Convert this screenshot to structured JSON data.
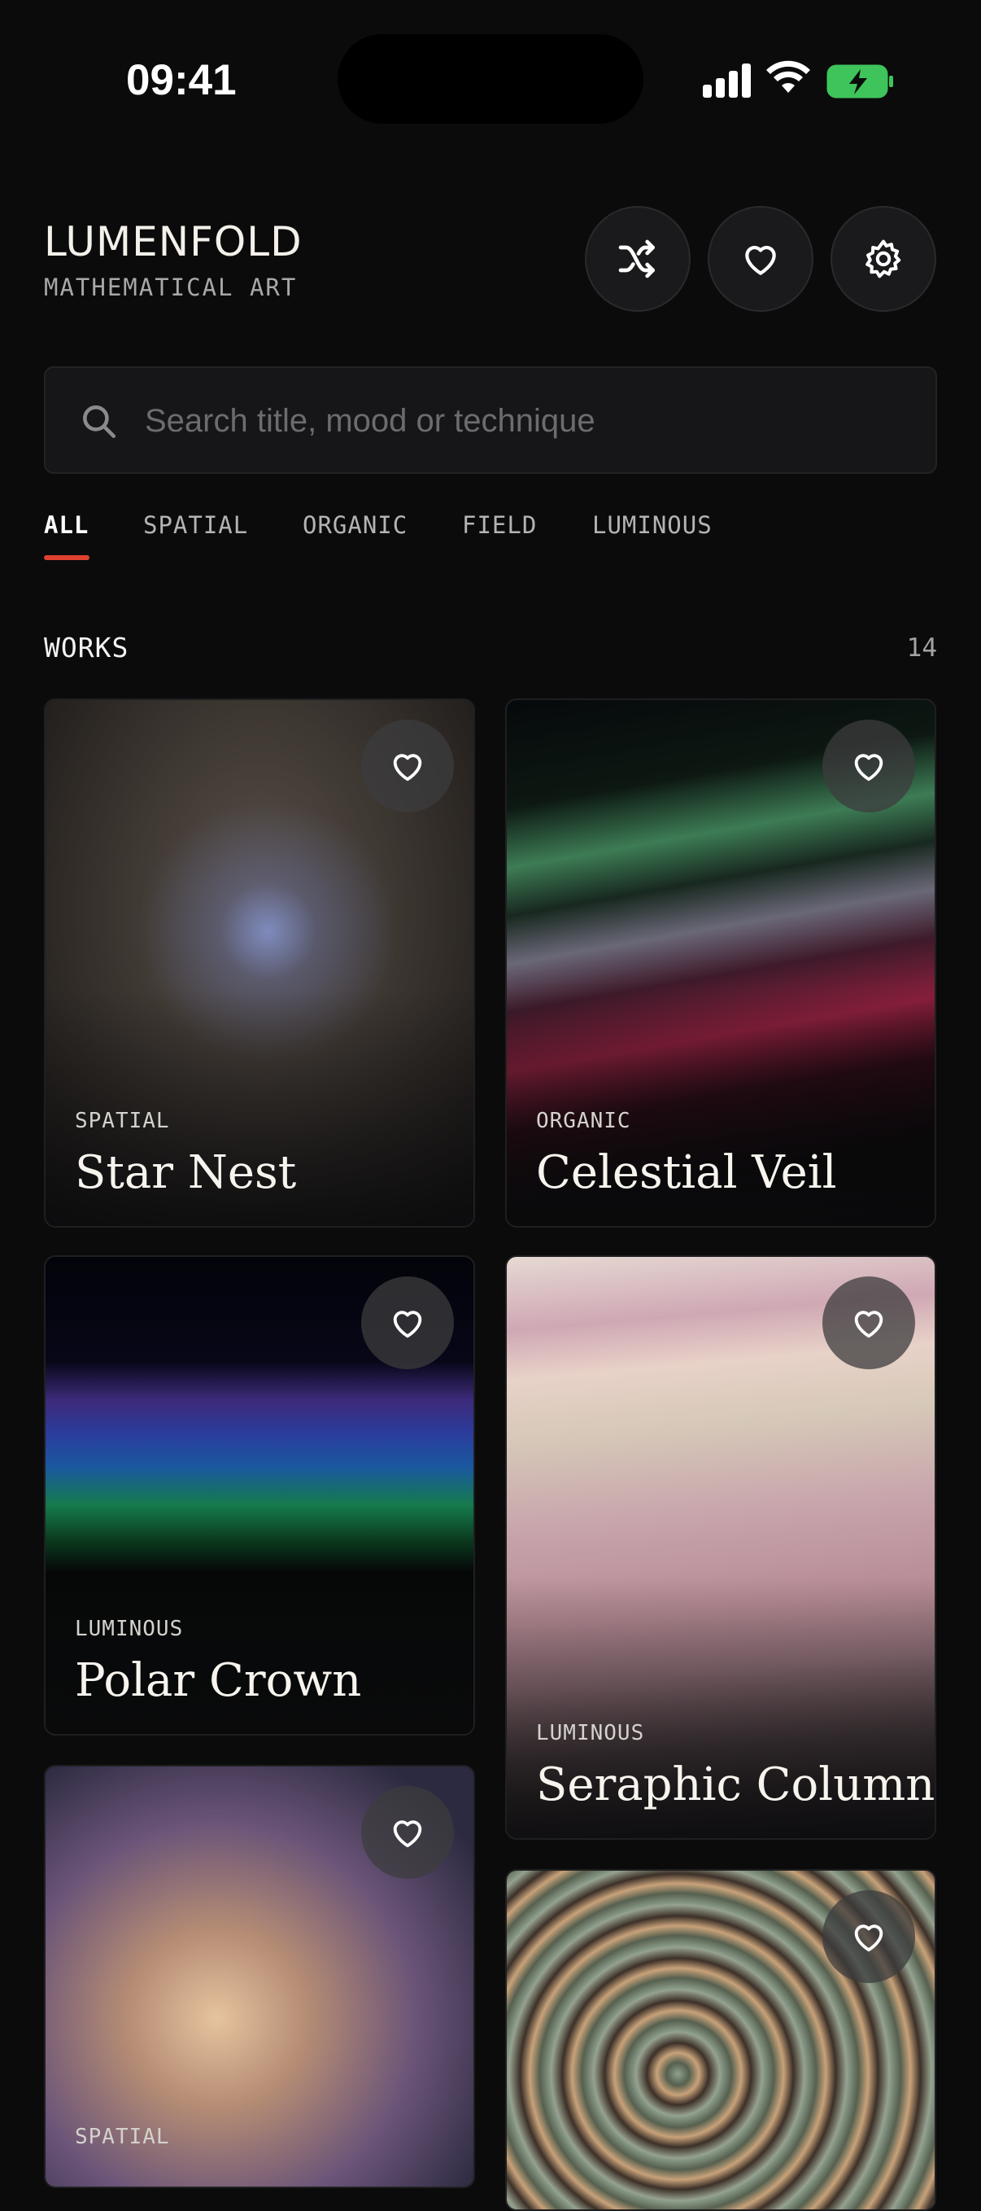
{
  "status_bar": {
    "time": "09:41"
  },
  "header": {
    "title": "LUMENFOLD",
    "subtitle": "MATHEMATICAL ART",
    "buttons": [
      "shuffle-icon",
      "heart-icon",
      "gear-icon"
    ]
  },
  "search": {
    "placeholder": "Search title, mood or technique",
    "value": ""
  },
  "tabs": [
    {
      "label": "ALL",
      "active": true
    },
    {
      "label": "SPATIAL",
      "active": false
    },
    {
      "label": "ORGANIC",
      "active": false
    },
    {
      "label": "FIELD",
      "active": false
    },
    {
      "label": "LUMINOUS",
      "active": false
    }
  ],
  "accent_color": "#e0412e",
  "works": {
    "label": "WORKS",
    "count": "14",
    "items": [
      {
        "category": "SPATIAL",
        "title": "Star Nest"
      },
      {
        "category": "ORGANIC",
        "title": "Celestial Veil"
      },
      {
        "category": "LUMINOUS",
        "title": "Polar Crown"
      },
      {
        "category": "LUMINOUS",
        "title": "Seraphic Column"
      },
      {
        "category": "SPATIAL",
        "title": ""
      },
      {
        "category": "",
        "title": ""
      }
    ]
  }
}
